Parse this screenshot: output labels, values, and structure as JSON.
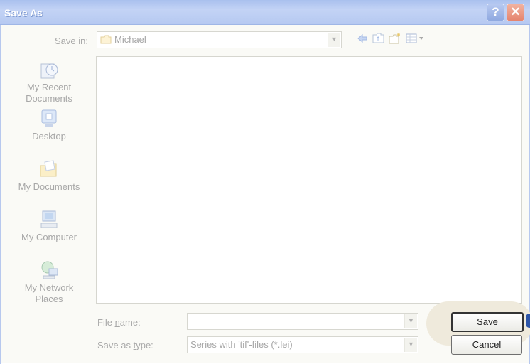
{
  "window": {
    "title": "Save As",
    "help_glyph": "?",
    "close_glyph": "✕"
  },
  "top": {
    "save_in_label_pre": "Save ",
    "save_in_label_u": "i",
    "save_in_label_post": "n:",
    "location_value": "Michael"
  },
  "toolbar": {
    "icons": [
      "back-icon",
      "up-folder-icon",
      "new-folder-icon",
      "view-menu-icon"
    ]
  },
  "places": [
    {
      "label_line1": "My Recent",
      "label_line2": "Documents",
      "icon": "recent-documents-icon"
    },
    {
      "label_line1": "Desktop",
      "label_line2": "",
      "icon": "desktop-icon"
    },
    {
      "label_line1": "My Documents",
      "label_line2": "",
      "icon": "my-documents-icon"
    },
    {
      "label_line1": "My Computer",
      "label_line2": "",
      "icon": "my-computer-icon"
    },
    {
      "label_line1": "My Network",
      "label_line2": "Places",
      "icon": "my-network-icon"
    }
  ],
  "bottom": {
    "file_name_label_pre": "File ",
    "file_name_label_u": "n",
    "file_name_label_post": "ame:",
    "file_name_value": "",
    "save_type_label_pre": "Save as ",
    "save_type_label_u": "t",
    "save_type_label_post": "ype:",
    "save_type_value": "Series with 'tif'-files  (*.lei)",
    "save_button_u": "S",
    "save_button_post": "ave",
    "cancel_button": "Cancel"
  },
  "colors": {
    "titlebar": "#a9c0ee",
    "accent": "#2d55a8"
  }
}
